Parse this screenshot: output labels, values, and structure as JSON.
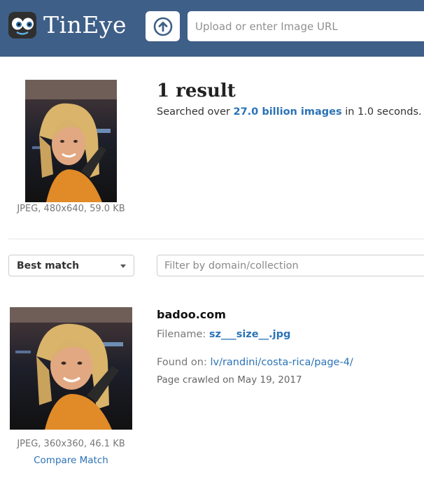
{
  "header": {
    "brand": "TinEye",
    "upload_icon": "upload-arrow-icon",
    "logo_icon": "tineye-robot-logo",
    "search_placeholder": "Upload or enter Image URL",
    "bg_color": "#3e5f87"
  },
  "query": {
    "image_alt": "Uploaded query image",
    "meta": "JPEG, 480x640, 59.0 KB",
    "result_count": "1 result",
    "searched_prefix": "Searched over ",
    "searched_count": "27.0 billion images",
    "searched_suffix": " in 1.0 seconds."
  },
  "controls": {
    "sort_label": "Best match",
    "filter_placeholder": "Filter by domain/collection"
  },
  "results": [
    {
      "domain": "badoo.com",
      "filename_label": "Filename: ",
      "filename": "sz___size__.jpg",
      "found_label": "Found on: ",
      "found_url": "lv/randini/costa-rica/page-4/",
      "crawled": "Page crawled on May 19, 2017",
      "meta": "JPEG, 360x360, 46.1 KB",
      "compare_label": "Compare Match"
    }
  ],
  "colors": {
    "link": "#2b73b6",
    "header": "#3e5f87"
  }
}
